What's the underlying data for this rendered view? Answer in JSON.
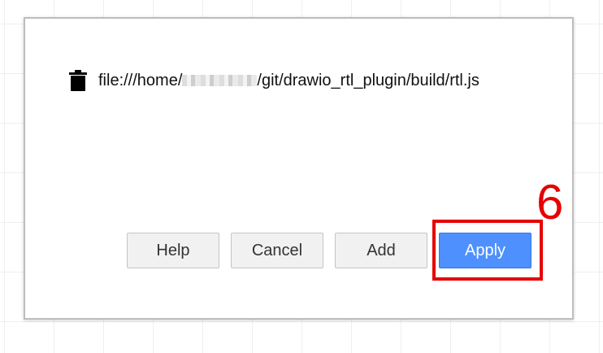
{
  "dialog": {
    "plugin_path_prefix": "file:///home/",
    "plugin_path_suffix": "/git/drawio_rtl_plugin/build/rtl.js",
    "delete_icon": "trash-icon",
    "buttons": {
      "help": "Help",
      "cancel": "Cancel",
      "add": "Add",
      "apply": "Apply"
    }
  },
  "annotation": {
    "step_number": "6",
    "color": "#e60000"
  },
  "colors": {
    "apply_button": "#4d90fe",
    "default_button": "#f1f1f1"
  }
}
